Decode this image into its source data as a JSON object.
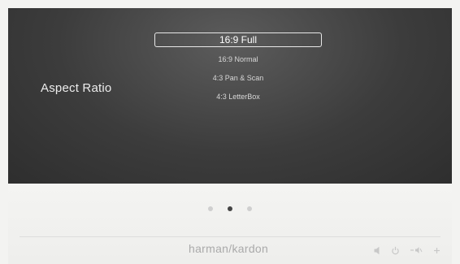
{
  "screen": {
    "label": "Aspect Ratio",
    "menu": [
      {
        "label": "16:9 Full",
        "selected": true
      },
      {
        "label": "16:9 Normal",
        "selected": false
      },
      {
        "label": "4:3 Pan & Scan",
        "selected": false
      },
      {
        "label": "4:3 LetterBox",
        "selected": false
      }
    ]
  },
  "pager": {
    "count": 3,
    "active_index": 1
  },
  "footer": {
    "brand_left": "harman",
    "brand_sep": "/",
    "brand_right": "kardon",
    "controls": [
      {
        "icon": "mute-speaker-icon"
      },
      {
        "icon": "power-icon"
      },
      {
        "icon": "volume-icon"
      },
      {
        "icon": "plus-icon"
      }
    ]
  },
  "colors": {
    "screen_bg": "#3c3c3c",
    "text_light": "#ececec",
    "panel_bg": "#f1f1ef",
    "dot_active": "#444444",
    "dot_inactive": "#cfcfcf",
    "brand": "#aaaaaa"
  }
}
